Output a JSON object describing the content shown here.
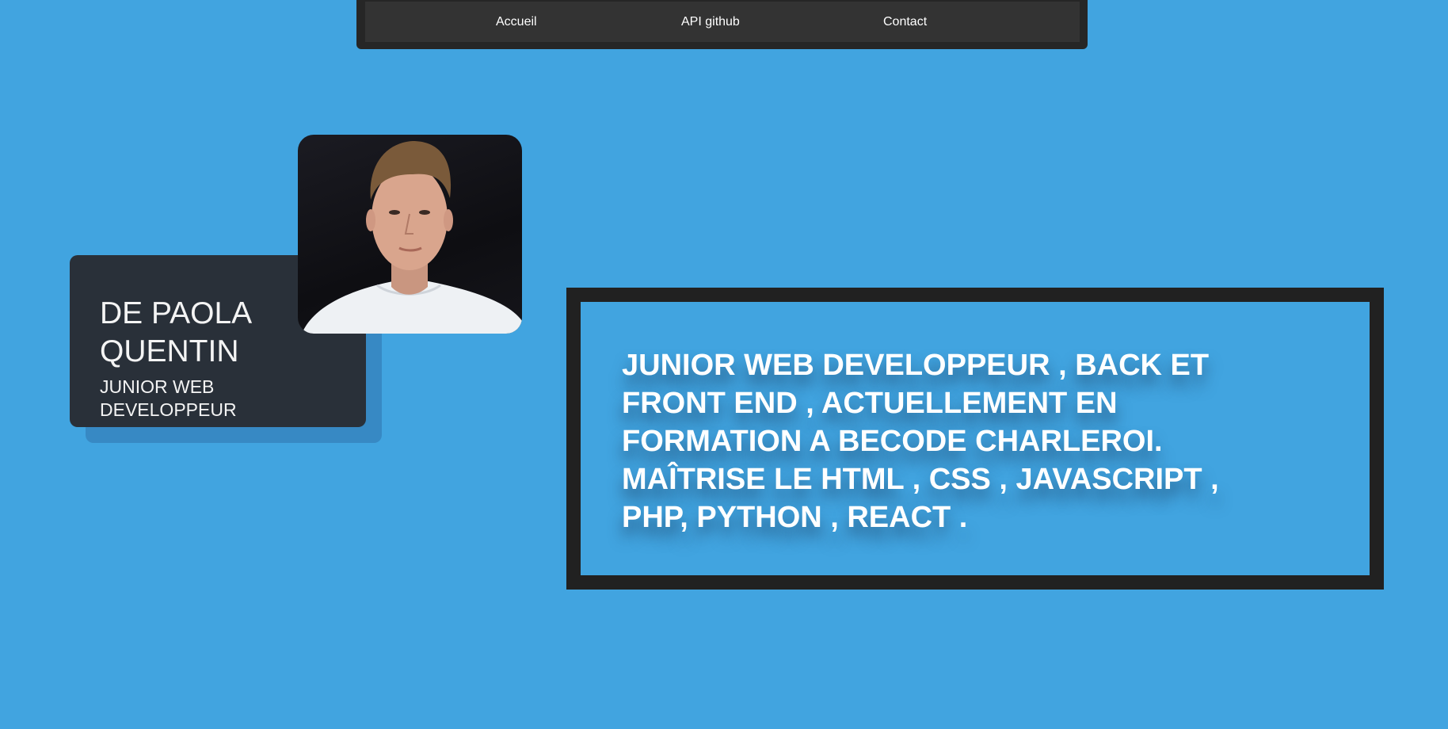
{
  "nav": {
    "links": [
      {
        "label": "Accueil"
      },
      {
        "label": "API github"
      },
      {
        "label": "Contact"
      }
    ]
  },
  "profile": {
    "name": "DE PAOLA QUENTIN",
    "role": "JUNIOR WEB DEVELOPPEUR",
    "photo": "profile-photo"
  },
  "about": {
    "text": "JUNIOR WEB DEVELOPPEUR , BACK ET FRONT END , ACTUELLEMENT EN FORMATION A BECODE CHARLEROI. MAÎTRISE LE HTML , CSS , JAVASCRIPT , PHP, PYTHON , REACT ."
  },
  "colors": {
    "background": "#41a4e0",
    "nav": "#333333",
    "card": "#293039",
    "frame": "#212121",
    "text": "#ffffff"
  }
}
